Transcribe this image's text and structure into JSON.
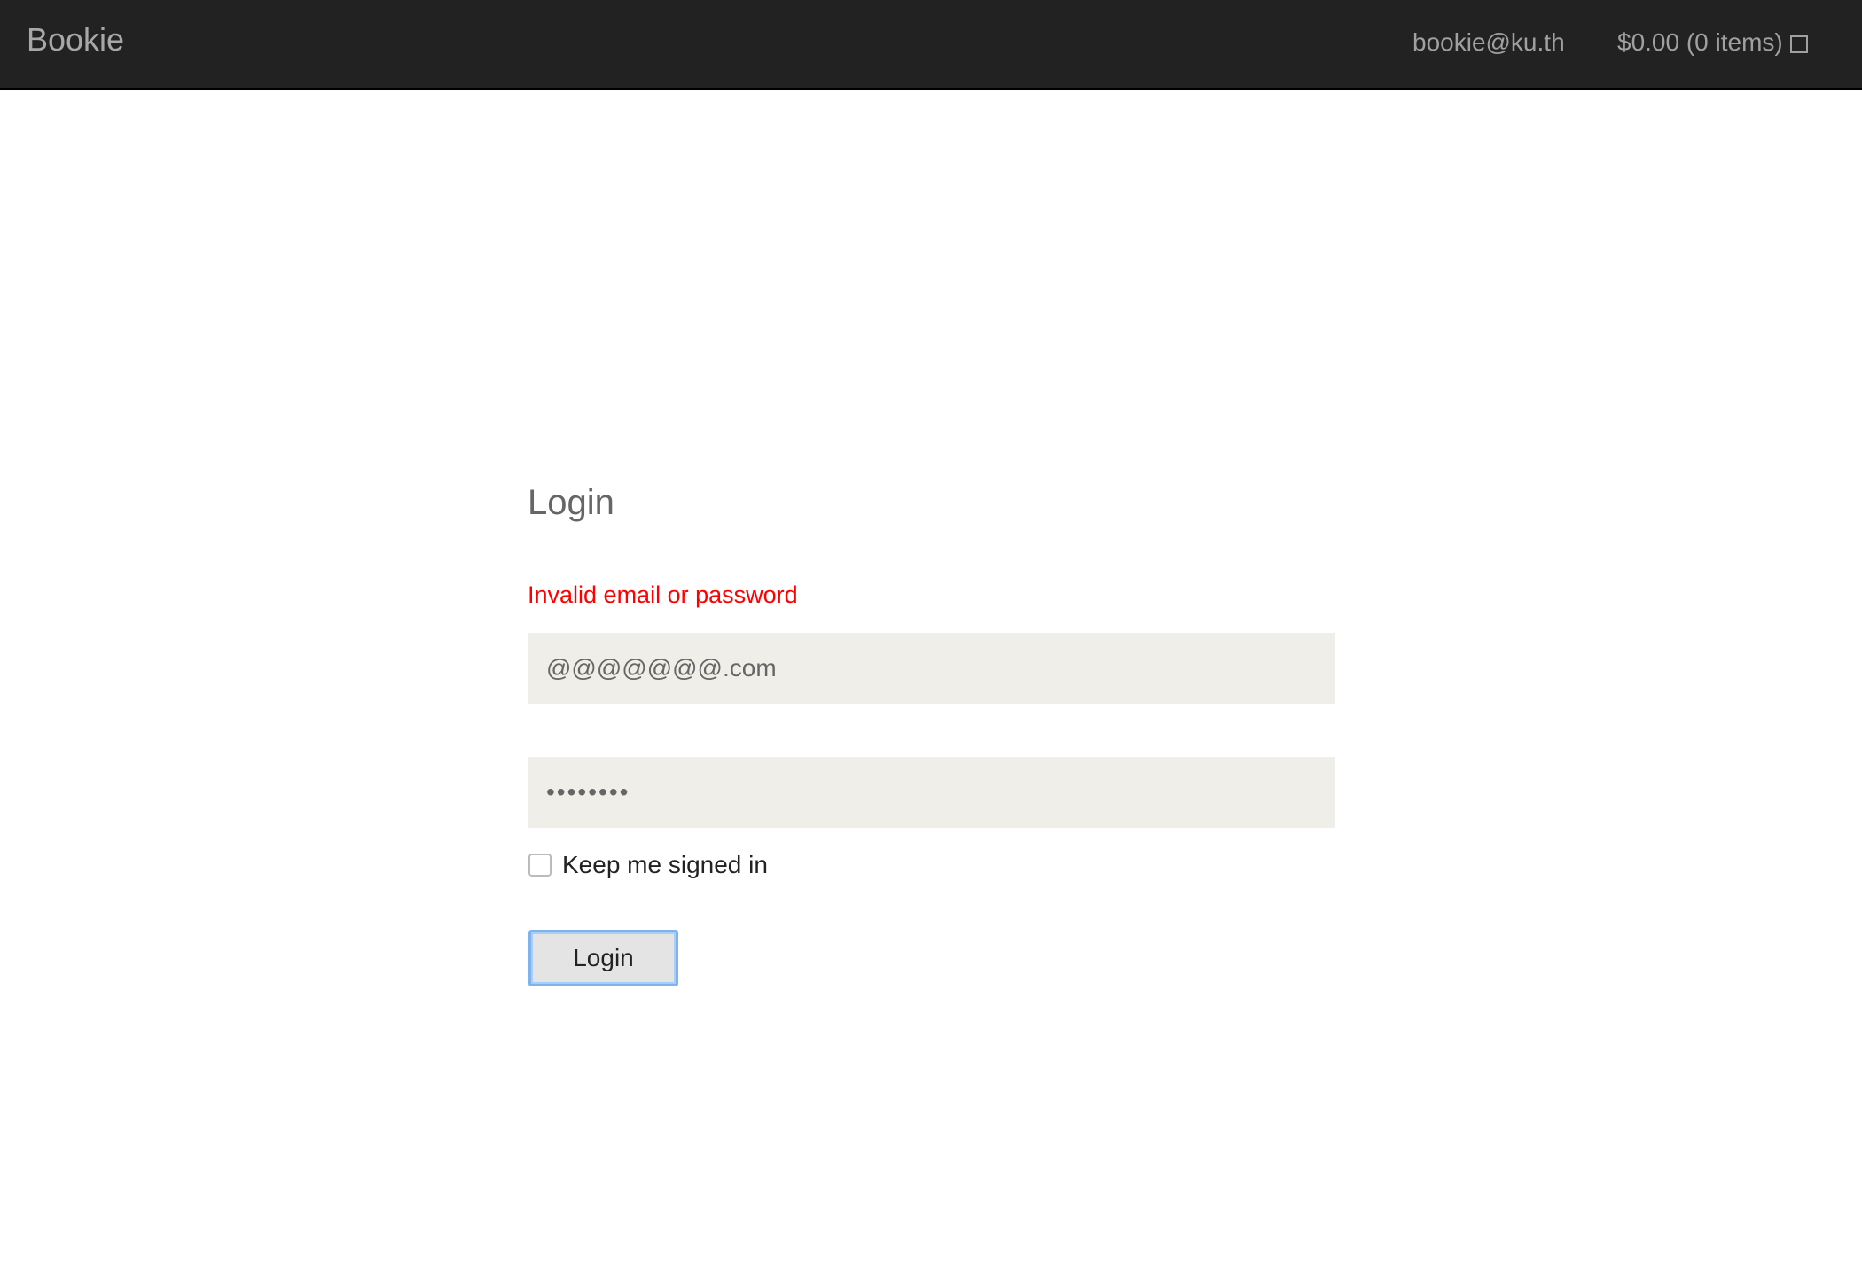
{
  "header": {
    "brand": "Bookie",
    "user_email": "bookie@ku.th",
    "cart_label": "$0.00 (0 items)",
    "cart_icon": "square-icon"
  },
  "login": {
    "title": "Login",
    "error": "Invalid email or password",
    "email_value": "@@@@@@@.com",
    "password_value": "••••••••",
    "keep_signed_in_label": "Keep me signed in",
    "keep_signed_in_checked": false,
    "submit_label": "Login"
  },
  "colors": {
    "error": "#ff0000",
    "nav_bg": "#222222",
    "input_bg": "#efeee8"
  }
}
